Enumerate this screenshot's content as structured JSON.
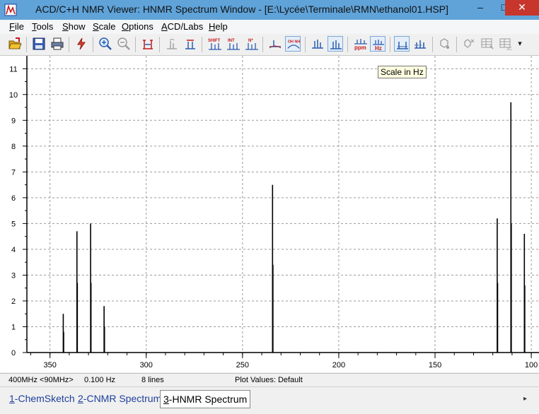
{
  "window": {
    "title": "ACD/C+H NMR Viewer: HNMR Spectrum Window - [E:\\Lycée\\Terminale\\RMN\\ethanol01.HSP]",
    "minimize_glyph": "–",
    "maximize_glyph": "□",
    "close_glyph": "✕"
  },
  "menu": [
    "File",
    "Tools",
    "Show",
    "Scale",
    "Options",
    "ACD/Labs",
    "Help"
  ],
  "toolbar": {
    "buttons": [
      {
        "icon": "open-folder-icon"
      },
      {
        "icon": "save-icon"
      },
      {
        "icon": "print-icon"
      },
      {
        "icon": "lightning-icon"
      },
      {
        "icon": "zoom-in-icon"
      },
      {
        "icon": "zoom-out-icon"
      },
      {
        "icon": "full-view-icon"
      },
      {
        "icon": "integral-icon"
      },
      {
        "icon": "coupling-icon"
      },
      {
        "icon": "shift-label-icon",
        "text": "SHIFT"
      },
      {
        "icon": "int-label-icon",
        "text": "INT"
      },
      {
        "icon": "nh-label-icon",
        "text": "N*"
      },
      {
        "icon": "baseline-icon"
      },
      {
        "icon": "oh-nh-icon",
        "text": "OH NH"
      },
      {
        "icon": "peaks-icon"
      },
      {
        "icon": "peaks-pressed-icon"
      },
      {
        "icon": "ppm-scale-icon",
        "text": "ppm"
      },
      {
        "icon": "hz-scale-icon",
        "text": "Hz"
      },
      {
        "icon": "spectrum-icon"
      },
      {
        "icon": "spectrum-grid-icon"
      },
      {
        "icon": "molecule-icon"
      },
      {
        "icon": "assign-icon"
      },
      {
        "icon": "table-icon"
      },
      {
        "icon": "table-export-icon"
      },
      {
        "icon": "overflow-icon",
        "text": "▾"
      }
    ],
    "tooltip": "Scale in Hz"
  },
  "chart_data": {
    "type": "line",
    "title": "",
    "xlabel": "",
    "ylabel": "",
    "xlim": [
      362,
      96
    ],
    "ylim": [
      0,
      11.5
    ],
    "xticks": [
      350,
      300,
      250,
      200,
      150,
      100
    ],
    "yticks": [
      0,
      1,
      2,
      3,
      4,
      5,
      6,
      7,
      8,
      9,
      10,
      11
    ],
    "grid": true,
    "peaks": [
      {
        "x": 343.1,
        "y": 1.5
      },
      {
        "x": 342.9,
        "y": 0.8
      },
      {
        "x": 336.0,
        "y": 4.7
      },
      {
        "x": 335.8,
        "y": 2.7
      },
      {
        "x": 328.9,
        "y": 5.0
      },
      {
        "x": 328.7,
        "y": 2.7
      },
      {
        "x": 321.9,
        "y": 1.8
      },
      {
        "x": 321.7,
        "y": 1.0
      },
      {
        "x": 234.4,
        "y": 6.5
      },
      {
        "x": 234.2,
        "y": 3.4
      },
      {
        "x": 117.7,
        "y": 5.2
      },
      {
        "x": 117.5,
        "y": 2.7
      },
      {
        "x": 110.6,
        "y": 9.7
      },
      {
        "x": 110.4,
        "y": 5.0
      },
      {
        "x": 103.6,
        "y": 4.6
      },
      {
        "x": 103.4,
        "y": 2.6
      }
    ],
    "color": "#000000"
  },
  "status": {
    "frequency": "400MHz <90MHz>",
    "resolution": "0.100 Hz",
    "lines": "8 lines",
    "plot_values": "Plot Values: Default"
  },
  "tabs": [
    {
      "num": "1",
      "label": "-ChemSketch"
    },
    {
      "num": "2",
      "label": "-CNMR Spectrum"
    },
    {
      "num": "3",
      "label": "-HNMR Spectrum",
      "active": true
    }
  ],
  "tabs_scroll": "▸"
}
